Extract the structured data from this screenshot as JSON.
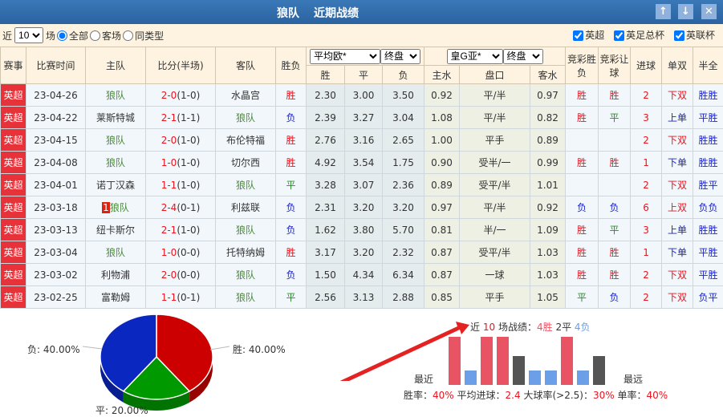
{
  "title": {
    "team": "狼队",
    "subtitle": "近期战绩"
  },
  "filter": {
    "near_label": "近",
    "count": "10",
    "unit_label": "场",
    "radios": [
      "全部",
      "客场",
      "同类型"
    ],
    "checkboxes": [
      "英超",
      "英足总杯",
      "英联杯"
    ]
  },
  "headers": {
    "league": "赛事",
    "time": "比赛时间",
    "home": "主队",
    "score": "比分(半场)",
    "away": "客队",
    "result": "胜负",
    "euro_select": "平均欧*",
    "euro_stage": "终盘",
    "asia_select": "皇G亚*",
    "asia_stage": "终盘",
    "win": "胜",
    "draw": "平",
    "lose": "负",
    "home_water": "主水",
    "handicap": "盘口",
    "away_water": "客水",
    "jc_result": "竞彩胜负",
    "jc_handicap": "竞彩让球",
    "goals": "进球",
    "oddeven": "单双",
    "half_full": "半全"
  },
  "rows": [
    {
      "league": "英超",
      "date": "23-04-26",
      "home": "狼队",
      "rank": "",
      "score": "2-0",
      "half": "(1-0)",
      "away": "水晶宫",
      "result": "胜",
      "w": "2.30",
      "d": "3.00",
      "l": "3.50",
      "hw": "0.92",
      "hc": "平/半",
      "aw": "0.97",
      "jc": "胜",
      "jr": "胜",
      "goals": "2",
      "oe": "下双",
      "hf": "胜胜"
    },
    {
      "league": "英超",
      "date": "23-04-22",
      "home": "莱斯特城",
      "rank": "",
      "score": "2-1",
      "half": "(1-1)",
      "away": "狼队",
      "result": "负",
      "w": "2.39",
      "d": "3.27",
      "l": "3.04",
      "hw": "1.08",
      "hc": "平/半",
      "aw": "0.82",
      "jc": "胜",
      "jr": "平",
      "goals": "3",
      "oe": "上单",
      "hf": "平胜"
    },
    {
      "league": "英超",
      "date": "23-04-15",
      "home": "狼队",
      "rank": "",
      "score": "2-0",
      "half": "(1-0)",
      "away": "布伦特福",
      "result": "胜",
      "w": "2.76",
      "d": "3.16",
      "l": "2.65",
      "hw": "1.00",
      "hc": "平手",
      "aw": "0.89",
      "jc": "",
      "jr": "",
      "goals": "2",
      "oe": "下双",
      "hf": "胜胜"
    },
    {
      "league": "英超",
      "date": "23-04-08",
      "home": "狼队",
      "rank": "",
      "score": "1-0",
      "half": "(1-0)",
      "away": "切尔西",
      "result": "胜",
      "w": "4.92",
      "d": "3.54",
      "l": "1.75",
      "hw": "0.90",
      "hc": "受半/一",
      "aw": "0.99",
      "jc": "胜",
      "jr": "胜",
      "goals": "1",
      "oe": "下单",
      "hf": "胜胜"
    },
    {
      "league": "英超",
      "date": "23-04-01",
      "home": "诺丁汉森",
      "rank": "",
      "score": "1-1",
      "half": "(1-0)",
      "away": "狼队",
      "result": "平",
      "w": "3.28",
      "d": "3.07",
      "l": "2.36",
      "hw": "0.89",
      "hc": "受平/半",
      "aw": "1.01",
      "jc": "",
      "jr": "",
      "goals": "2",
      "oe": "下双",
      "hf": "胜平"
    },
    {
      "league": "英超",
      "date": "23-03-18",
      "home": "狼队",
      "rank": "1",
      "score": "2-4",
      "half": "(0-1)",
      "away": "利兹联",
      "result": "负",
      "w": "2.31",
      "d": "3.20",
      "l": "3.20",
      "hw": "0.97",
      "hc": "平/半",
      "aw": "0.92",
      "jc": "负",
      "jr": "负",
      "goals": "6",
      "oe": "上双",
      "hf": "负负"
    },
    {
      "league": "英超",
      "date": "23-03-13",
      "home": "纽卡斯尔",
      "rank": "",
      "score": "2-1",
      "half": "(1-0)",
      "away": "狼队",
      "result": "负",
      "w": "1.62",
      "d": "3.80",
      "l": "5.70",
      "hw": "0.81",
      "hc": "半/一",
      "aw": "1.09",
      "jc": "胜",
      "jr": "平",
      "goals": "3",
      "oe": "上单",
      "hf": "胜胜"
    },
    {
      "league": "英超",
      "date": "23-03-04",
      "home": "狼队",
      "rank": "",
      "score": "1-0",
      "half": "(0-0)",
      "away": "托特纳姆",
      "result": "胜",
      "w": "3.17",
      "d": "3.20",
      "l": "2.32",
      "hw": "0.87",
      "hc": "受平/半",
      "aw": "1.03",
      "jc": "胜",
      "jr": "胜",
      "goals": "1",
      "oe": "下单",
      "hf": "平胜"
    },
    {
      "league": "英超",
      "date": "23-03-02",
      "home": "利物浦",
      "rank": "",
      "score": "2-0",
      "half": "(0-0)",
      "away": "狼队",
      "result": "负",
      "w": "1.50",
      "d": "4.34",
      "l": "6.34",
      "hw": "0.87",
      "hc": "一球",
      "aw": "1.03",
      "jc": "胜",
      "jr": "胜",
      "goals": "2",
      "oe": "下双",
      "hf": "平胜"
    },
    {
      "league": "英超",
      "date": "23-02-25",
      "home": "富勒姆",
      "rank": "",
      "score": "1-1",
      "half": "(0-1)",
      "away": "狼队",
      "result": "平",
      "w": "2.56",
      "d": "3.13",
      "l": "2.88",
      "hw": "0.85",
      "hc": "平手",
      "aw": "1.05",
      "jc": "平",
      "jr": "负",
      "goals": "2",
      "oe": "下双",
      "hf": "负平"
    }
  ],
  "chart_data": [
    {
      "type": "pie",
      "slices": [
        {
          "label": "胜",
          "value": 40,
          "text": "胜: 40.00%",
          "color": "#cc0000"
        },
        {
          "label": "平",
          "value": 20,
          "text": "平: 20.00%",
          "color": "#009900"
        },
        {
          "label": "负",
          "value": 40,
          "text": "负: 40.00%",
          "color": "#0a28c0"
        }
      ]
    },
    {
      "type": "bar",
      "title_parts": [
        "近",
        "10",
        "场战绩：",
        "4胜",
        "2平",
        "4负"
      ],
      "results": [
        "胜",
        "负",
        "胜",
        "胜",
        "平",
        "负",
        "负",
        "胜",
        "负",
        "平"
      ],
      "left_label": "最近",
      "right_label": "最远",
      "colors": {
        "胜": "#e85464",
        "平": "#555555",
        "负": "#6ba0e8"
      }
    }
  ],
  "stats": {
    "win_rate_label": "胜率：",
    "win_rate": "40%",
    "avg_goals_label": "平均进球：",
    "avg_goals": "2.4",
    "over_label": "大球率(>2.5)：",
    "over": "30%",
    "odd_label": "单率：",
    "odd": "40%"
  }
}
